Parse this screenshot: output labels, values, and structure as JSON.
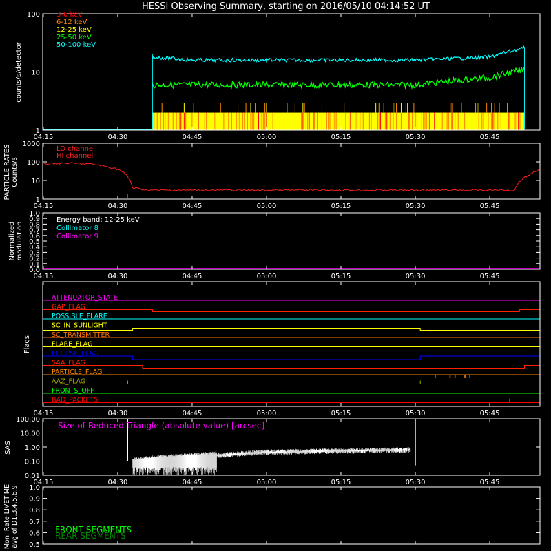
{
  "title": "HESSI Observing Summary, starting on 2016/05/10 04:14:52 UT",
  "time_axis": {
    "ticks": [
      "04:15",
      "04:30",
      "04:45",
      "05:00",
      "05:15",
      "05:30",
      "05:45"
    ],
    "range": [
      "04:15",
      "05:55"
    ]
  },
  "colors": {
    "background": "#000000",
    "axis": "#ffffff",
    "band_3_6": "#ff0000",
    "band_6_12": "#ff8c00",
    "band_12_25": "#ffff00",
    "band_25_50": "#00ff00",
    "band_50_100": "#00ffff",
    "magenta": "#ff00ff"
  },
  "panels": {
    "counts": {
      "ylabel": "counts/s/detector",
      "yticks": [
        "1",
        "10",
        "100"
      ],
      "legend": [
        "3-6 keV",
        "6-12 keV",
        "12-25 keV",
        "25-50 keV",
        "50-100 keV"
      ]
    },
    "particle": {
      "ylabel1": "PARTICLE RATES",
      "ylabel2": "Counts/s",
      "yticks": [
        "1",
        "10",
        "100",
        "1000"
      ],
      "legend": [
        "LO channel",
        "HI channel"
      ]
    },
    "modulation": {
      "ylabel1": "Normalized",
      "ylabel2": "modulation",
      "yticks": [
        "0.0",
        "0.1",
        "0.2",
        "0.3",
        "0.4",
        "0.5",
        "0.6",
        "0.7",
        "0.8",
        "0.9",
        "1.0"
      ],
      "legend": [
        "Energy band: 12-25 keV",
        "Collimator 8",
        "Collimator 9"
      ]
    },
    "flags": {
      "ylabel": "Flags",
      "items": [
        {
          "name": "ATTENUATOR_STATE",
          "color": "#ff00ff"
        },
        {
          "name": "GAP_FLAG",
          "color": "#ff2200"
        },
        {
          "name": "POSSIBLE_FLARE",
          "color": "#00ffff"
        },
        {
          "name": "SC_IN_SUNLIGHT",
          "color": "#ffff00"
        },
        {
          "name": "SC_TRANSMITTER",
          "color": "#ff7700"
        },
        {
          "name": "FLARE_FLAG",
          "color": "#ffff00"
        },
        {
          "name": "ECLIPSE_FLAG",
          "color": "#0000ff"
        },
        {
          "name": "SAA_FLAG",
          "color": "#ff2200"
        },
        {
          "name": "PARTICLE_FLAG",
          "color": "#ff8800"
        },
        {
          "name": "AAZ_FLAG",
          "color": "#aaaa00"
        },
        {
          "name": "FRONTS_OFF",
          "color": "#00ff00"
        },
        {
          "name": "BAD_PACKETS",
          "color": "#ff0000"
        }
      ]
    },
    "sas": {
      "ylabel": "SAS",
      "yticks": [
        "0.01",
        "0.10",
        "1.00",
        "10.00",
        "100.00"
      ],
      "legend": "Size of Reduced Triangle (absolute value) [arcsec]"
    },
    "livetime": {
      "ylabel1": "Mon. Rate LIVETIME",
      "ylabel2": "avg of D1,3,4,5,6,9",
      "yticks": [
        "0.5",
        "0.6",
        "0.7",
        "0.8",
        "0.9",
        "1.0"
      ],
      "legend": [
        "FRONT SEGMENTS",
        "REAR SEGMENTS"
      ]
    }
  },
  "chart_data": [
    {
      "type": "line",
      "title": "HESSI Observing Summary, starting on 2016/05/10 04:14:52 UT",
      "ylabel": "counts/s/detector",
      "yscale": "log",
      "ylim": [
        1,
        100
      ],
      "x_unit": "UT time",
      "series": [
        {
          "name": "50-100 keV",
          "x": [
            "04:15",
            "04:37",
            "04:45",
            "05:00",
            "05:15",
            "05:30",
            "05:45",
            "05:52"
          ],
          "y": [
            1,
            18,
            16,
            16,
            16,
            16,
            18,
            26
          ]
        },
        {
          "name": "25-50 keV",
          "x": [
            "04:37",
            "04:45",
            "05:00",
            "05:15",
            "05:30",
            "05:45",
            "05:52"
          ],
          "y": [
            6,
            6,
            6,
            6,
            6,
            8,
            11
          ]
        },
        {
          "name": "12-25 keV",
          "x": [
            "04:37",
            "05:52"
          ],
          "y": [
            2,
            2
          ]
        },
        {
          "name": "6-12 keV",
          "x": [
            "04:37",
            "05:52"
          ],
          "y": [
            2,
            2
          ]
        }
      ]
    },
    {
      "type": "line",
      "ylabel": "PARTICLE RATES Counts/s",
      "yscale": "log",
      "ylim": [
        1,
        1000
      ],
      "series": [
        {
          "name": "LO channel",
          "x": [
            "04:15",
            "04:20",
            "04:25",
            "04:30",
            "04:33",
            "04:36",
            "05:00",
            "05:30",
            "05:50",
            "05:53",
            "05:55"
          ],
          "y": [
            80,
            85,
            75,
            40,
            4,
            3,
            3,
            3,
            3,
            20,
            40
          ]
        }
      ]
    },
    {
      "type": "line",
      "ylabel": "Normalized modulation",
      "ylim": [
        0.0,
        1.0
      ],
      "series": [
        {
          "name": "Collimator 9",
          "x": [
            "04:15",
            "05:55"
          ],
          "y": [
            0.0,
            0.0
          ]
        }
      ]
    },
    {
      "type": "line",
      "ylabel": "SAS",
      "yscale": "log",
      "ylim": [
        0.01,
        100
      ],
      "series": [
        {
          "name": "Size of Reduced Triangle",
          "x": [
            "04:32",
            "04:33",
            "04:40",
            "04:50",
            "05:00",
            "05:15",
            "05:29",
            "05:30"
          ],
          "y": [
            100,
            0.2,
            0.1,
            0.2,
            0.45,
            0.55,
            0.65,
            100
          ]
        }
      ]
    }
  ]
}
